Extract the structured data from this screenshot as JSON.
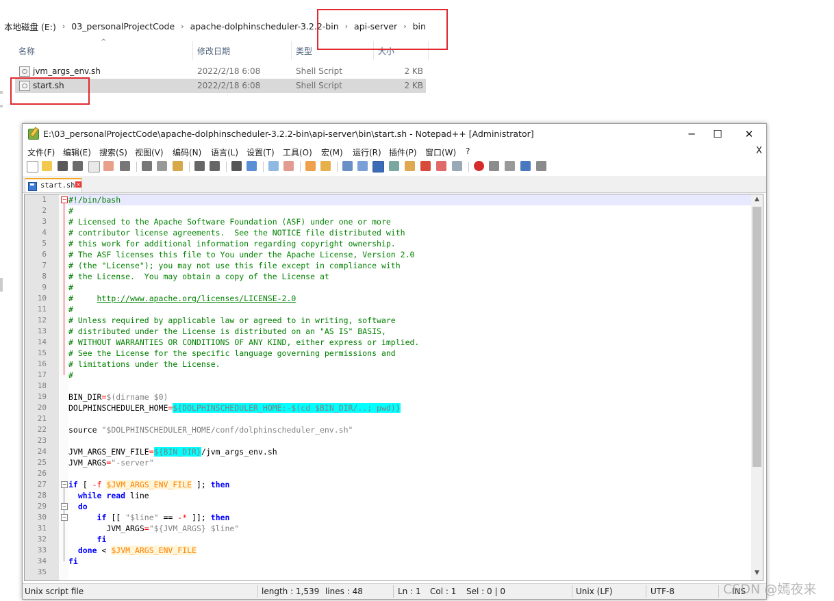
{
  "explorer": {
    "breadcrumb": [
      "本地磁盘 (E:)",
      "03_personalProjectCode",
      "apache-dolphinscheduler-3.2.2-bin",
      "api-server",
      "bin"
    ],
    "columns": {
      "name": "名称",
      "modified": "修改日期",
      "type": "类型",
      "size": "大小"
    },
    "files": [
      {
        "name": "jvm_args_env.sh",
        "modified": "2022/2/18 6:08",
        "type": "Shell Script",
        "size": "2 KB"
      },
      {
        "name": "start.sh",
        "modified": "2022/2/18 6:08",
        "type": "Shell Script",
        "size": "2 KB"
      }
    ]
  },
  "npp": {
    "title": "E:\\03_personalProjectCode\\apache-dolphinscheduler-3.2.2-bin\\api-server\\bin\\start.sh - Notepad++ [Administrator]",
    "window_buttons": {
      "minimize": "─",
      "maximize": "☐",
      "close": "✕"
    },
    "menu": [
      "文件(F)",
      "编辑(E)",
      "搜索(S)",
      "视图(V)",
      "编码(N)",
      "语言(L)",
      "设置(T)",
      "工具(O)",
      "宏(M)",
      "运行(R)",
      "插件(P)",
      "窗口(W)",
      "?"
    ],
    "menu_close": "X",
    "tab": {
      "label": "start.sh",
      "close": "×"
    },
    "status": {
      "file_type": "Unix script file",
      "length": "length : 1,539",
      "lines": "lines : 48",
      "ln": "Ln : 1",
      "col": "Col : 1",
      "sel": "Sel : 0 | 0",
      "eol": "Unix (LF)",
      "encoding": "UTF-8",
      "mode": "INS"
    }
  },
  "watermark": "CSDN @嫣夜来",
  "colors": {
    "redbox": "#e0282e",
    "hl": "#00ffff",
    "comment": "#008000",
    "keyword": "#0000ff"
  }
}
